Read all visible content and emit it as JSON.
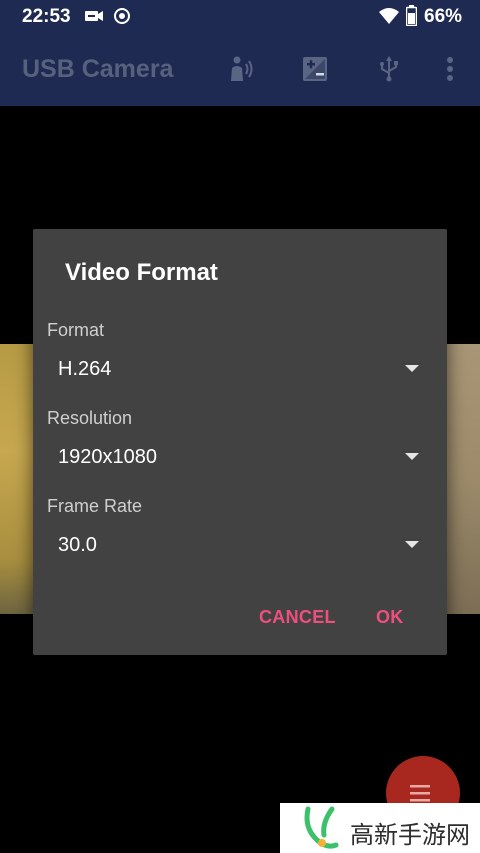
{
  "status_bar": {
    "time": "22:53",
    "battery": "66%",
    "icons": [
      "usb-camera-notification-icon",
      "record-notification-icon",
      "wifi-icon",
      "battery-icon"
    ]
  },
  "toolbar": {
    "title": "USB Camera",
    "actions": [
      "voice-call-icon",
      "exposure-icon",
      "usb-icon",
      "overflow-menu-icon"
    ]
  },
  "dialog": {
    "title": "Video Format",
    "fields": [
      {
        "label": "Format",
        "value": "H.264"
      },
      {
        "label": "Resolution",
        "value": "1920x1080"
      },
      {
        "label": "Frame Rate",
        "value": "30.0"
      }
    ],
    "cancel_label": "CANCEL",
    "ok_label": "OK"
  },
  "fab": {
    "icon": "menu-list-icon"
  },
  "watermark": {
    "text": "高新手游网",
    "logo": "watermark-logo"
  },
  "colors": {
    "app_bar": "#1f2a52",
    "dialog_bg": "#424242",
    "accent": "#ee4f7e",
    "fab": "#a8281f"
  }
}
